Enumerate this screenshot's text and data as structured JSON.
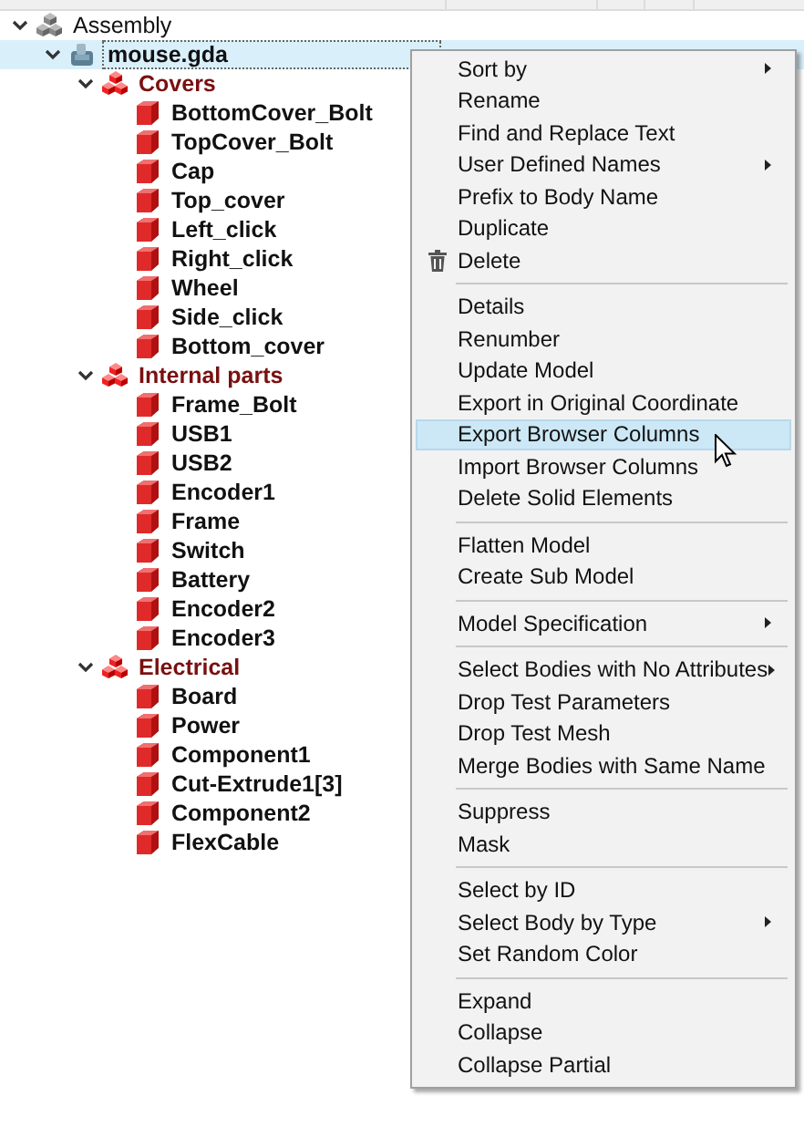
{
  "tree": [
    {
      "label": "Assembly",
      "kind": "assembly",
      "expanded": true,
      "selected": false,
      "children": [
        {
          "label": "mouse.gda",
          "kind": "model",
          "expanded": true,
          "selected": true,
          "children": [
            {
              "label": "Covers",
              "kind": "group",
              "expanded": true,
              "selected": false,
              "children": [
                {
                  "label": "BottomCover_Bolt",
                  "kind": "part",
                  "selected": false
                },
                {
                  "label": "TopCover_Bolt",
                  "kind": "part",
                  "selected": false
                },
                {
                  "label": "Cap",
                  "kind": "part",
                  "selected": false
                },
                {
                  "label": "Top_cover",
                  "kind": "part",
                  "selected": false
                },
                {
                  "label": "Left_click",
                  "kind": "part",
                  "selected": false
                },
                {
                  "label": "Right_click",
                  "kind": "part",
                  "selected": false
                },
                {
                  "label": "Wheel",
                  "kind": "part",
                  "selected": false
                },
                {
                  "label": "Side_click",
                  "kind": "part",
                  "selected": false
                },
                {
                  "label": "Bottom_cover",
                  "kind": "part",
                  "selected": false
                }
              ]
            },
            {
              "label": "Internal parts",
              "kind": "group",
              "expanded": true,
              "selected": false,
              "children": [
                {
                  "label": "Frame_Bolt",
                  "kind": "part",
                  "selected": false
                },
                {
                  "label": "USB1",
                  "kind": "part",
                  "selected": false
                },
                {
                  "label": "USB2",
                  "kind": "part",
                  "selected": false
                },
                {
                  "label": "Encoder1",
                  "kind": "part",
                  "selected": false
                },
                {
                  "label": "Frame",
                  "kind": "part",
                  "selected": false
                },
                {
                  "label": "Switch",
                  "kind": "part",
                  "selected": false
                },
                {
                  "label": "Battery",
                  "kind": "part",
                  "selected": false
                },
                {
                  "label": "Encoder2",
                  "kind": "part",
                  "selected": false
                },
                {
                  "label": "Encoder3",
                  "kind": "part",
                  "selected": false
                }
              ]
            },
            {
              "label": "Electrical",
              "kind": "group",
              "expanded": true,
              "selected": false,
              "children": [
                {
                  "label": "Board",
                  "kind": "part",
                  "selected": false
                },
                {
                  "label": "Power",
                  "kind": "part",
                  "selected": false
                },
                {
                  "label": "Component1",
                  "kind": "part",
                  "selected": false
                },
                {
                  "label": "Cut-Extrude1[3]",
                  "kind": "part",
                  "selected": false
                },
                {
                  "label": "Component2",
                  "kind": "part",
                  "selected": false
                },
                {
                  "label": "FlexCable",
                  "kind": "part",
                  "selected": false
                }
              ]
            }
          ]
        }
      ]
    }
  ],
  "context_menu": {
    "groups": [
      [
        {
          "label": "Sort by",
          "submenu": true,
          "selected": false
        },
        {
          "label": "Rename",
          "submenu": false,
          "selected": false
        },
        {
          "label": "Find and Replace Text",
          "submenu": false,
          "selected": false
        },
        {
          "label": "User Defined Names",
          "submenu": true,
          "selected": false
        },
        {
          "label": "Prefix to Body Name",
          "submenu": false,
          "selected": false
        },
        {
          "label": "Duplicate",
          "submenu": false,
          "selected": false
        },
        {
          "label": "Delete",
          "submenu": false,
          "selected": false,
          "has_icon": true
        }
      ],
      [
        {
          "label": "Details",
          "submenu": false,
          "selected": false
        },
        {
          "label": "Renumber",
          "submenu": false,
          "selected": false
        },
        {
          "label": "Update Model",
          "submenu": false,
          "selected": false
        },
        {
          "label": "Export in Original Coordinate",
          "submenu": false,
          "selected": false
        },
        {
          "label": "Export Browser Columns",
          "submenu": false,
          "selected": true
        },
        {
          "label": "Import Browser Columns",
          "submenu": false,
          "selected": false
        },
        {
          "label": "Delete Solid Elements",
          "submenu": false,
          "selected": false
        }
      ],
      [
        {
          "label": "Flatten Model",
          "submenu": false,
          "selected": false
        },
        {
          "label": "Create Sub Model",
          "submenu": false,
          "selected": false
        }
      ],
      [
        {
          "label": "Model Specification",
          "submenu": true,
          "selected": false
        }
      ],
      [
        {
          "label": "Select Bodies with No Attributes",
          "submenu": true,
          "selected": false
        },
        {
          "label": "Drop Test Parameters",
          "submenu": false,
          "selected": false
        },
        {
          "label": "Drop Test Mesh",
          "submenu": false,
          "selected": false
        },
        {
          "label": "Merge Bodies with Same Name",
          "submenu": false,
          "selected": false
        }
      ],
      [
        {
          "label": "Suppress",
          "submenu": false,
          "selected": false
        },
        {
          "label": "Mask",
          "submenu": false,
          "selected": false
        }
      ],
      [
        {
          "label": "Select by ID",
          "submenu": false,
          "selected": false
        },
        {
          "label": "Select Body by Type",
          "submenu": true,
          "selected": false
        },
        {
          "label": "Set Random Color",
          "submenu": false,
          "selected": false
        }
      ],
      [
        {
          "label": "Expand",
          "submenu": false,
          "selected": false
        },
        {
          "label": "Collapse",
          "submenu": false,
          "selected": false
        },
        {
          "label": "Collapse Partial",
          "submenu": false,
          "selected": false
        }
      ]
    ]
  }
}
